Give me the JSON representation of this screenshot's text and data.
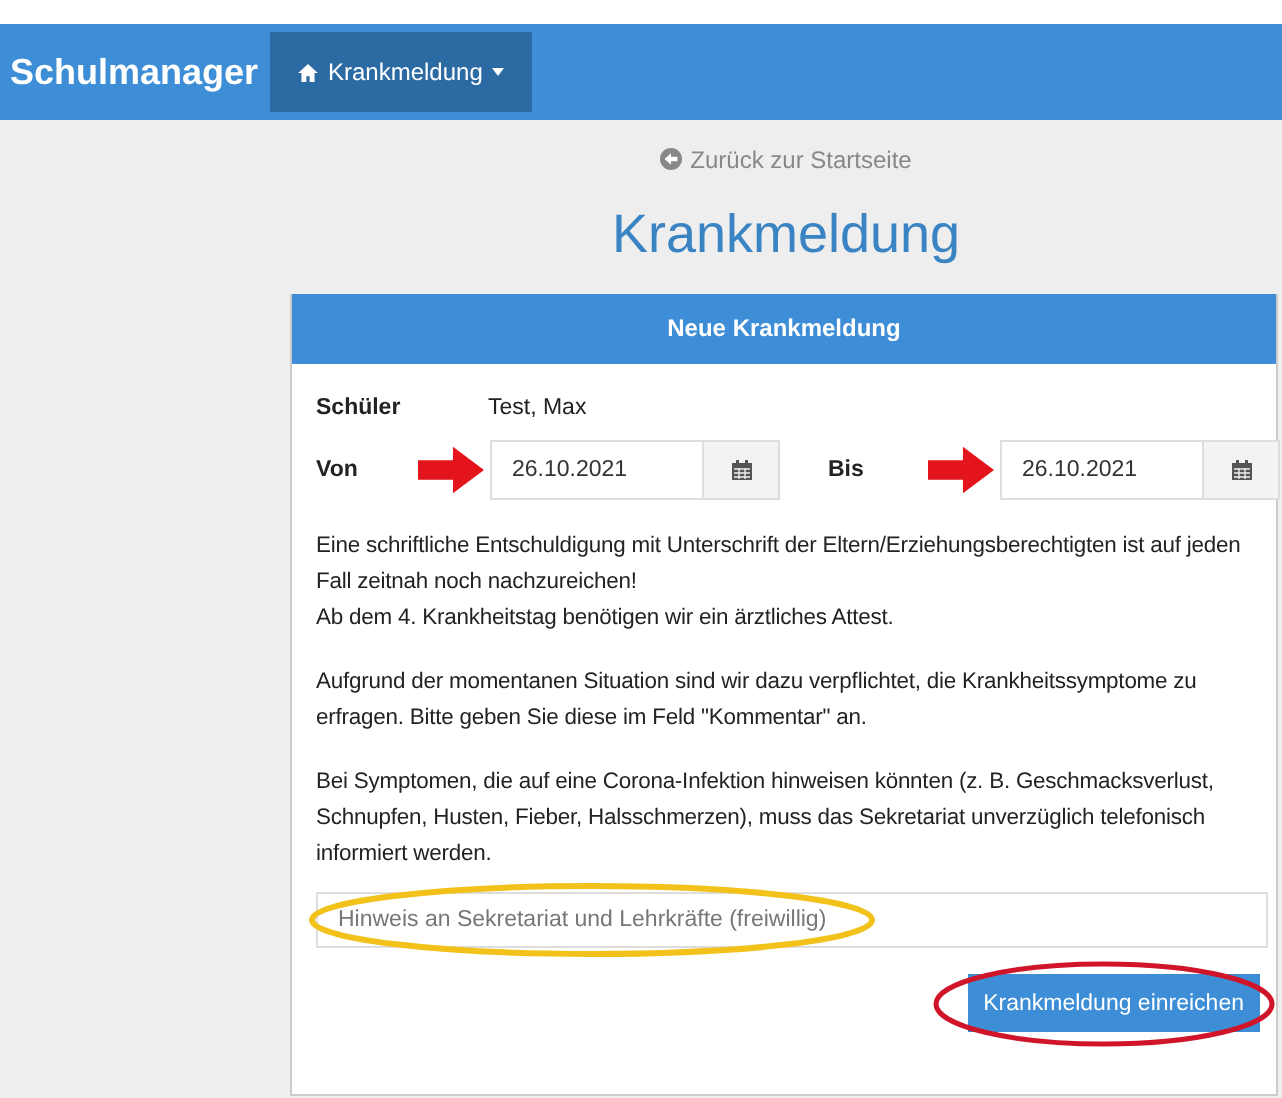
{
  "navbar": {
    "brand": "Schulmanager",
    "menu_label": "Krankmeldung"
  },
  "back_link": "Zurück zur Startseite",
  "page_title": "Krankmeldung",
  "panel": {
    "title": "Neue Krankmeldung",
    "student": {
      "label": "Schüler",
      "value": "Test, Max"
    },
    "dates": [
      {
        "label": "Von",
        "value": "26.10.2021"
      },
      {
        "label": "Bis",
        "value": "26.10.2021"
      }
    ],
    "paragraphs": [
      [
        "Eine schriftliche Entschuldigung mit Unterschrift der Eltern/Erziehungsberechtigten ist auf jeden Fall zeitnah noch nachzureichen!",
        "Ab dem 4. Krankheitstag benötigen wir ein ärztliches Attest."
      ],
      [
        "Aufgrund der momentanen Situation sind wir dazu verpflichtet, die Krankheitssymptome zu erfragen. Bitte geben Sie diese im Feld \"Kommentar\" an."
      ],
      [
        "Bei Symptomen, die auf eine Corona-Infektion hinweisen könnten (z. B. Geschmacksverlust, Schnupfen, Husten, Fieber, Halsschmerzen), muss das Sekretariat unverzüglich telefonisch informiert werden."
      ]
    ],
    "comment": {
      "placeholder": "Hinweis an Sekretariat und Lehrkräfte (freiwillig)"
    },
    "submit": "Krankmeldung einreichen"
  }
}
